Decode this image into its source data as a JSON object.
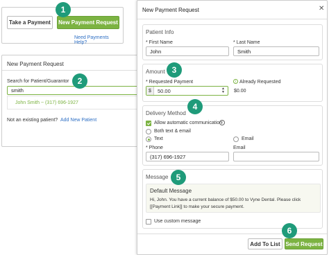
{
  "toolbar": {
    "take_payment_label": "Take a Payment",
    "new_payment_request_label": "New Payment Request",
    "help_link": "Need Payments Help?"
  },
  "search_panel": {
    "title": "New Payment Request",
    "search_label": "Search for Patient/Guarantor",
    "search_value": "smith",
    "result": "John Smith ~ (317) 696-1927",
    "not_existing_label": "Not an existing patient?",
    "add_new_label": "Add New Patient"
  },
  "dialog": {
    "title": "New Payment Request",
    "patient_info": {
      "title": "Patient Info",
      "first_name_label": "* First Name",
      "first_name_value": "John",
      "last_name_label": "* Last Name",
      "last_name_value": "Smith"
    },
    "amount": {
      "title": "Amount",
      "requested_label": "* Requested Payment",
      "currency_symbol": "$",
      "requested_value": "50.00",
      "already_requested_label": "Already Requested",
      "already_requested_value": "$0.00"
    },
    "delivery": {
      "title": "Delivery Method",
      "allow_auto_label": "Allow automatic communication",
      "allow_auto_checked": true,
      "options": [
        "Both text & email",
        "Text",
        "Email"
      ],
      "selected": "Text",
      "phone_label": "* Phone",
      "phone_value": "(317) 696-1927",
      "email_label": "Email",
      "email_value": ""
    },
    "message": {
      "title": "Message",
      "default_title": "Default Message",
      "default_body_line1": "Hi, John. You have a current balance of $50.00 to Vyne Dental. Please click",
      "default_body_line2": "[[Payment Link]] to make your secure payment.",
      "custom_label": "Use custom message",
      "custom_checked": false
    },
    "add_to_list_label": "Add To List",
    "send_request_label": "Send Request"
  },
  "badges": [
    "1",
    "2",
    "3",
    "4",
    "5",
    "6"
  ],
  "colors": {
    "accent_green": "#7cb342",
    "badge_teal": "#1f9b7a",
    "link_blue": "#2e6fc4"
  }
}
